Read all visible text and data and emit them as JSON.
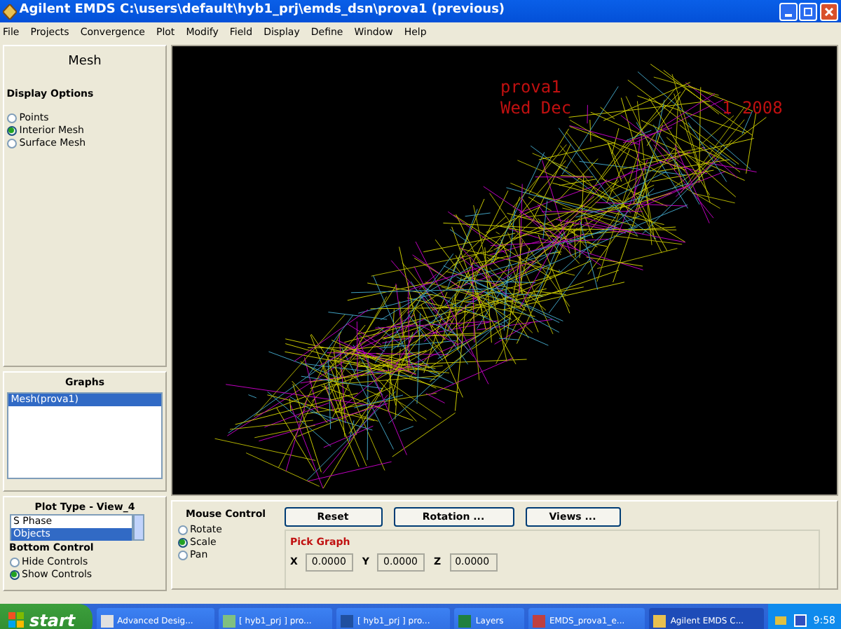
{
  "window": {
    "title": "Agilent EMDS C:\\users\\default\\hyb1_prj\\emds_dsn\\prova1 (previous)"
  },
  "menu": [
    "File",
    "Projects",
    "Convergence",
    "Plot",
    "Modify",
    "Field",
    "Display",
    "Define",
    "Window",
    "Help"
  ],
  "mesh_panel": {
    "title": "Mesh",
    "section": "Display Options",
    "options": [
      {
        "label": "Points",
        "selected": false
      },
      {
        "label": "Interior Mesh",
        "selected": true
      },
      {
        "label": "Surface Mesh",
        "selected": false
      }
    ]
  },
  "graphs": {
    "title": "Graphs",
    "items": [
      {
        "label": "Mesh(prova1)",
        "selected": true
      }
    ]
  },
  "plot_type": {
    "title": "Plot Type - View_4",
    "items": [
      {
        "label": "S Phase",
        "selected": false
      },
      {
        "label": "Objects",
        "selected": true
      }
    ]
  },
  "bottom_control": {
    "title": "Bottom Control",
    "options": [
      {
        "label": "Hide Controls",
        "selected": false
      },
      {
        "label": "Show Controls",
        "selected": true
      }
    ]
  },
  "viewport": {
    "label": "prova1",
    "date_parts": [
      "Wed Dec",
      "1 2008"
    ]
  },
  "mouse_control": {
    "title": "Mouse Control",
    "options": [
      {
        "label": "Rotate",
        "selected": false
      },
      {
        "label": "Scale",
        "selected": true
      },
      {
        "label": "Pan",
        "selected": false
      }
    ]
  },
  "buttons": [
    "Reset",
    "Rotation ...",
    "Views ..."
  ],
  "pick_graph": {
    "title": "Pick Graph",
    "fields": [
      {
        "label": "X",
        "value": "0.0000"
      },
      {
        "label": "Y",
        "value": "0.0000"
      },
      {
        "label": "Z",
        "value": "0.0000"
      }
    ]
  },
  "taskbar": {
    "start": "start",
    "tasks": [
      {
        "label": "Advanced Desig...",
        "selected": false
      },
      {
        "label": "[ hyb1_prj ] pro...",
        "selected": false
      },
      {
        "label": "[ hyb1_prj ] pro...",
        "selected": false
      },
      {
        "label": "Layers",
        "selected": false
      },
      {
        "label": "EMDS_prova1_e...",
        "selected": false
      },
      {
        "label": "Agilent EMDS C...",
        "selected": true
      }
    ],
    "clock": "9:58"
  }
}
